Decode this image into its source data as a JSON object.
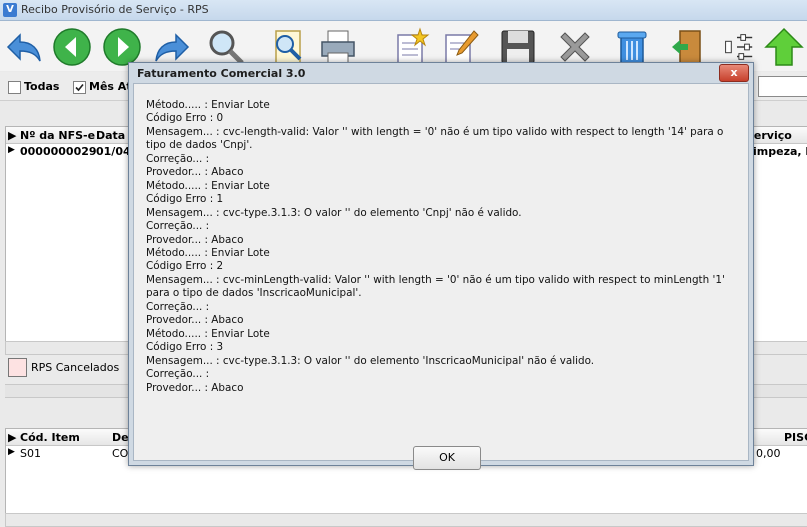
{
  "window": {
    "title": "Recibo Provisório de Serviço - RPS",
    "app_icon": "V"
  },
  "toolbar": {
    "buttons": [
      "back-arrow-icon",
      "previous-icon",
      "next-icon",
      "forward-arrow-icon",
      "search-icon",
      "search-document-icon",
      "printer-icon",
      "new-document-icon",
      "edit-document-icon",
      "save-disk-icon",
      "delete-x-icon",
      "trash-icon",
      "exit-door-icon",
      "settings-sliders-icon",
      "up-arrow-icon"
    ]
  },
  "filters": {
    "todas_label": "Todas",
    "todas_checked": false,
    "mes_label": "Mês At",
    "mes_checked": true
  },
  "grid_main": {
    "headers": {
      "nfse": "Nº da NFS-e",
      "data": "Data (",
      "servico": "Serviço"
    },
    "row": {
      "nfse": "0000000029",
      "data": "01/04",
      "servico": "Limpeza, lu"
    }
  },
  "legend": {
    "label": "RPS Cancelados",
    "color": "#fde2e2"
  },
  "grid_items": {
    "headers": {
      "cod": "Cód. Item",
      "de": "De",
      "pis": "PISC"
    },
    "row": {
      "cod": "S01",
      "de": "CO",
      "pis": "0,00"
    }
  },
  "modal": {
    "title": "Faturamento Comercial 3.0",
    "close_label": "x",
    "ok_label": "OK",
    "lines": [
      "Método..... : Enviar Lote",
      "Código Erro : 0",
      "Mensagem... : cvc-length-valid: Valor '' with length = '0' não é um tipo valido with respect to length '14' para o tipo de dados 'Cnpj'.",
      "Correção... :",
      "Provedor... : Abaco",
      "Método..... : Enviar Lote",
      "Código Erro : 1",
      "Mensagem... : cvc-type.3.1.3: O valor '' do elemento 'Cnpj' não é valido.",
      "Correção... :",
      "Provedor... : Abaco",
      "Método..... : Enviar Lote",
      "Código Erro : 2",
      "Mensagem... : cvc-minLength-valid: Valor '' with length = '0' não é um tipo valido with respect to minLength '1' para o tipo de dados 'InscricaoMunicipal'.",
      "Correção... :",
      "Provedor... : Abaco",
      "Método..... : Enviar Lote",
      "Código Erro : 3",
      "Mensagem... : cvc-type.3.1.3: O valor '' do elemento 'InscricaoMunicipal' não é valido.",
      "Correção... :",
      "Provedor... : Abaco"
    ]
  }
}
